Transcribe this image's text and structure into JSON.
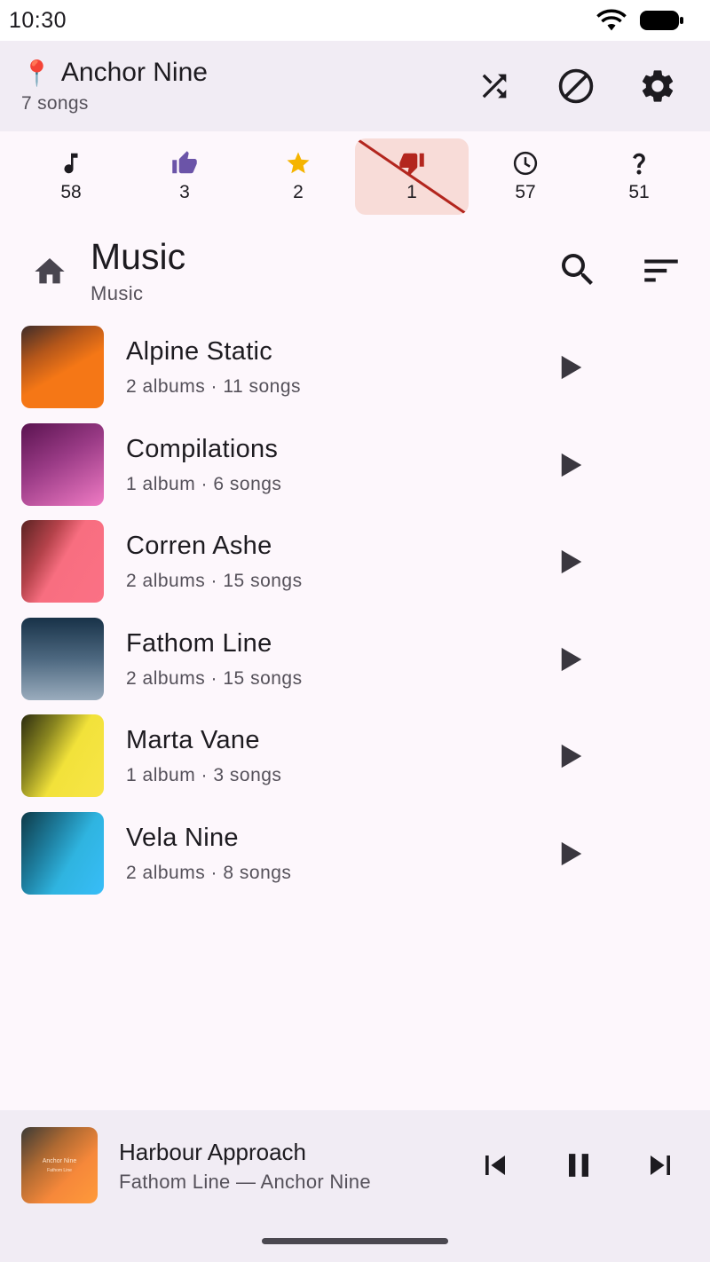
{
  "status": {
    "time": "10:30"
  },
  "header": {
    "pin_emoji": "📍",
    "title": "Anchor Nine",
    "subtitle": "7 songs"
  },
  "filters": [
    {
      "icon": "music-note-icon",
      "count": "58"
    },
    {
      "icon": "thumbs-up-icon",
      "count": "3"
    },
    {
      "icon": "star-icon",
      "count": "2"
    },
    {
      "icon": "thumbs-down-icon",
      "count": "1",
      "active": true
    },
    {
      "icon": "clock-icon",
      "count": "57"
    },
    {
      "icon": "question-icon",
      "count": "51"
    }
  ],
  "section": {
    "title": "Music",
    "breadcrumb": "Music"
  },
  "artists": [
    {
      "name": "Alpine Static",
      "meta": "2 albums · 11 songs"
    },
    {
      "name": "Compilations",
      "meta": "1 album · 6 songs"
    },
    {
      "name": "Corren Ashe",
      "meta": "2 albums · 15 songs"
    },
    {
      "name": "Fathom Line",
      "meta": "2 albums · 15 songs"
    },
    {
      "name": "Marta Vane",
      "meta": "1 album · 3 songs"
    },
    {
      "name": "Vela Nine",
      "meta": "2 albums · 8 songs"
    }
  ],
  "now_playing": {
    "title": "Harbour Approach",
    "subtitle": "Fathom Line — Anchor Nine",
    "art_text": "Anchor Nine",
    "art_subtext": "Fathom Line"
  },
  "colors": {
    "accent": "#6750a4",
    "thumb_up": "#6b54a8",
    "star": "#f5b400",
    "thumb_down": "#b3261e",
    "active_filter_bg": "#f8dcd8"
  }
}
